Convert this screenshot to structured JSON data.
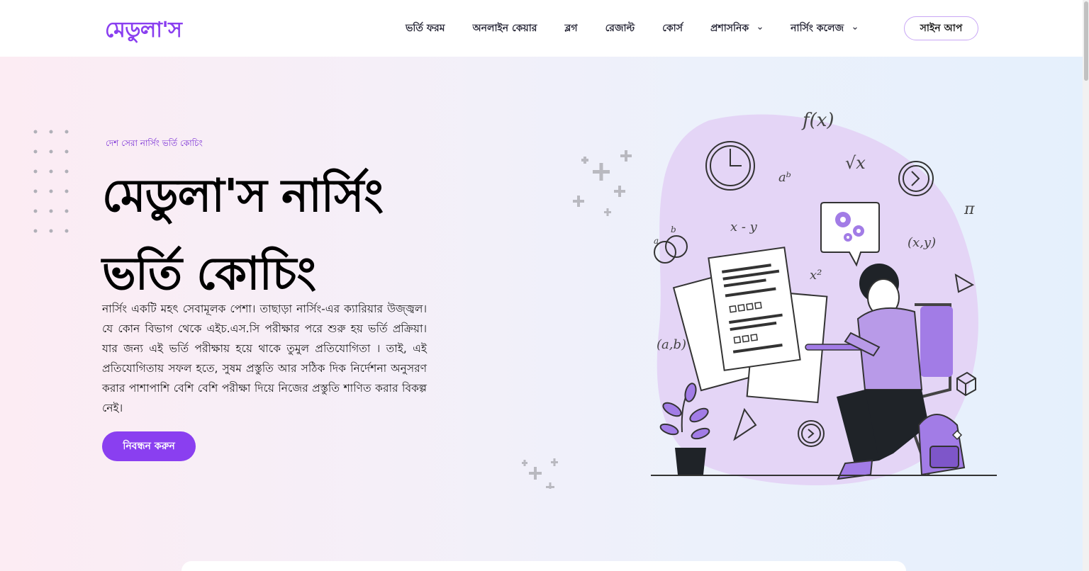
{
  "header": {
    "logo": "মেডুলা'স",
    "nav": [
      {
        "label": "ভর্তি ফরম",
        "dropdown": false
      },
      {
        "label": "অনলাইন কেয়ার",
        "dropdown": false
      },
      {
        "label": "ব্লগ",
        "dropdown": false
      },
      {
        "label": "রেজাল্ট",
        "dropdown": false
      },
      {
        "label": "কোর্স",
        "dropdown": false
      },
      {
        "label": "প্রশাসনিক",
        "dropdown": true
      },
      {
        "label": "নার্সিং কলেজ",
        "dropdown": true
      }
    ],
    "signup_label": "সাইন আপ"
  },
  "hero": {
    "tagline": "দেশ সেরা নার্সিং ভর্তি কোচিং",
    "title_line1": "মেডুলা'স নার্সিং",
    "title_line2": "ভর্তি কোচিং",
    "description": "নার্সিং একটি মহৎ সেবামূলক পেশা। তাছাড়া নার্সিং-এর ক্যারিয়ার উজ্জ্বল। যে কোন বিভাগ থেকে এইচ.এস.সি পরীক্ষার পরে শুরু হয় ভর্তি প্রক্রিয়া। যার জন্য এই ভর্তি পরীক্ষায় হয়ে থাকে তুমুল প্রতিযোগিতা । তাই, এই প্রতিযোগিতায় সফল হতে, সুষম প্রস্তুতি আর সঠিক দিক নির্দেশনা অনুসরণ করার পাশাপাশি বেশি বেশি পরীক্ষা দিয়ে নিজের প্রস্তুতি শাণিত করার বিকল্প নেই।",
    "cta_label": "নিবন্ধন করুন"
  },
  "illustration": {
    "icon": "student-studying-illustration",
    "math_labels": {
      "fx": "f(x)",
      "ab_power": "aᵇ",
      "sqrt": "√x",
      "x_minus_y": "x - y",
      "x_squared": "x²",
      "pi": "π",
      "ab_pair": "(a,b)",
      "xy_pair": "(x,y)",
      "a": "a",
      "b": "b"
    }
  },
  "colors": {
    "brand": "#8a3ff0",
    "illustration_blob": "#e4d5f6",
    "illustration_accent": "#a27ce6"
  }
}
